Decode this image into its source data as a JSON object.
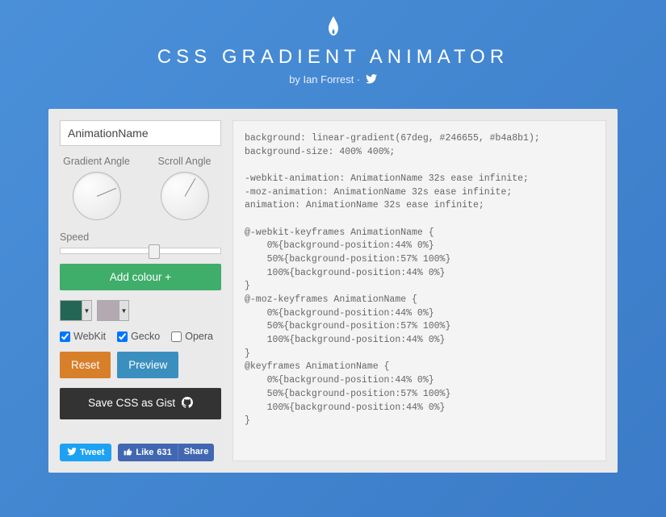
{
  "header": {
    "title": "CSS GRADIENT ANIMATOR",
    "byline_prefix": "by ",
    "byline_author": "Ian Forrest",
    "byline_separator": " · "
  },
  "controls": {
    "animation_name_value": "AnimationName",
    "gradient_angle_label": "Gradient Angle",
    "scroll_angle_label": "Scroll Angle",
    "gradient_angle_deg": 67,
    "scroll_angle_deg": -60,
    "speed_label": "Speed",
    "speed_position_pct": 55,
    "add_colour_label": "Add colour +",
    "colours": [
      "#246655",
      "#b4a8b1"
    ],
    "prefixes": {
      "webkit_label": "WebKit",
      "webkit_checked": true,
      "gecko_label": "Gecko",
      "gecko_checked": true,
      "opera_label": "Opera",
      "opera_checked": false
    },
    "reset_label": "Reset",
    "preview_label": "Preview",
    "gist_label": "Save CSS as Gist"
  },
  "social": {
    "tweet_label": "Tweet",
    "like_label": "Like",
    "like_count": "631",
    "share_label": "Share"
  },
  "code_output": "background: linear-gradient(67deg, #246655, #b4a8b1);\nbackground-size: 400% 400%;\n\n-webkit-animation: AnimationName 32s ease infinite;\n-moz-animation: AnimationName 32s ease infinite;\nanimation: AnimationName 32s ease infinite;\n\n@-webkit-keyframes AnimationName {\n    0%{background-position:44% 0%}\n    50%{background-position:57% 100%}\n    100%{background-position:44% 0%}\n}\n@-moz-keyframes AnimationName {\n    0%{background-position:44% 0%}\n    50%{background-position:57% 100%}\n    100%{background-position:44% 0%}\n}\n@keyframes AnimationName {\n    0%{background-position:44% 0%}\n    50%{background-position:57% 100%}\n    100%{background-position:44% 0%}\n}"
}
